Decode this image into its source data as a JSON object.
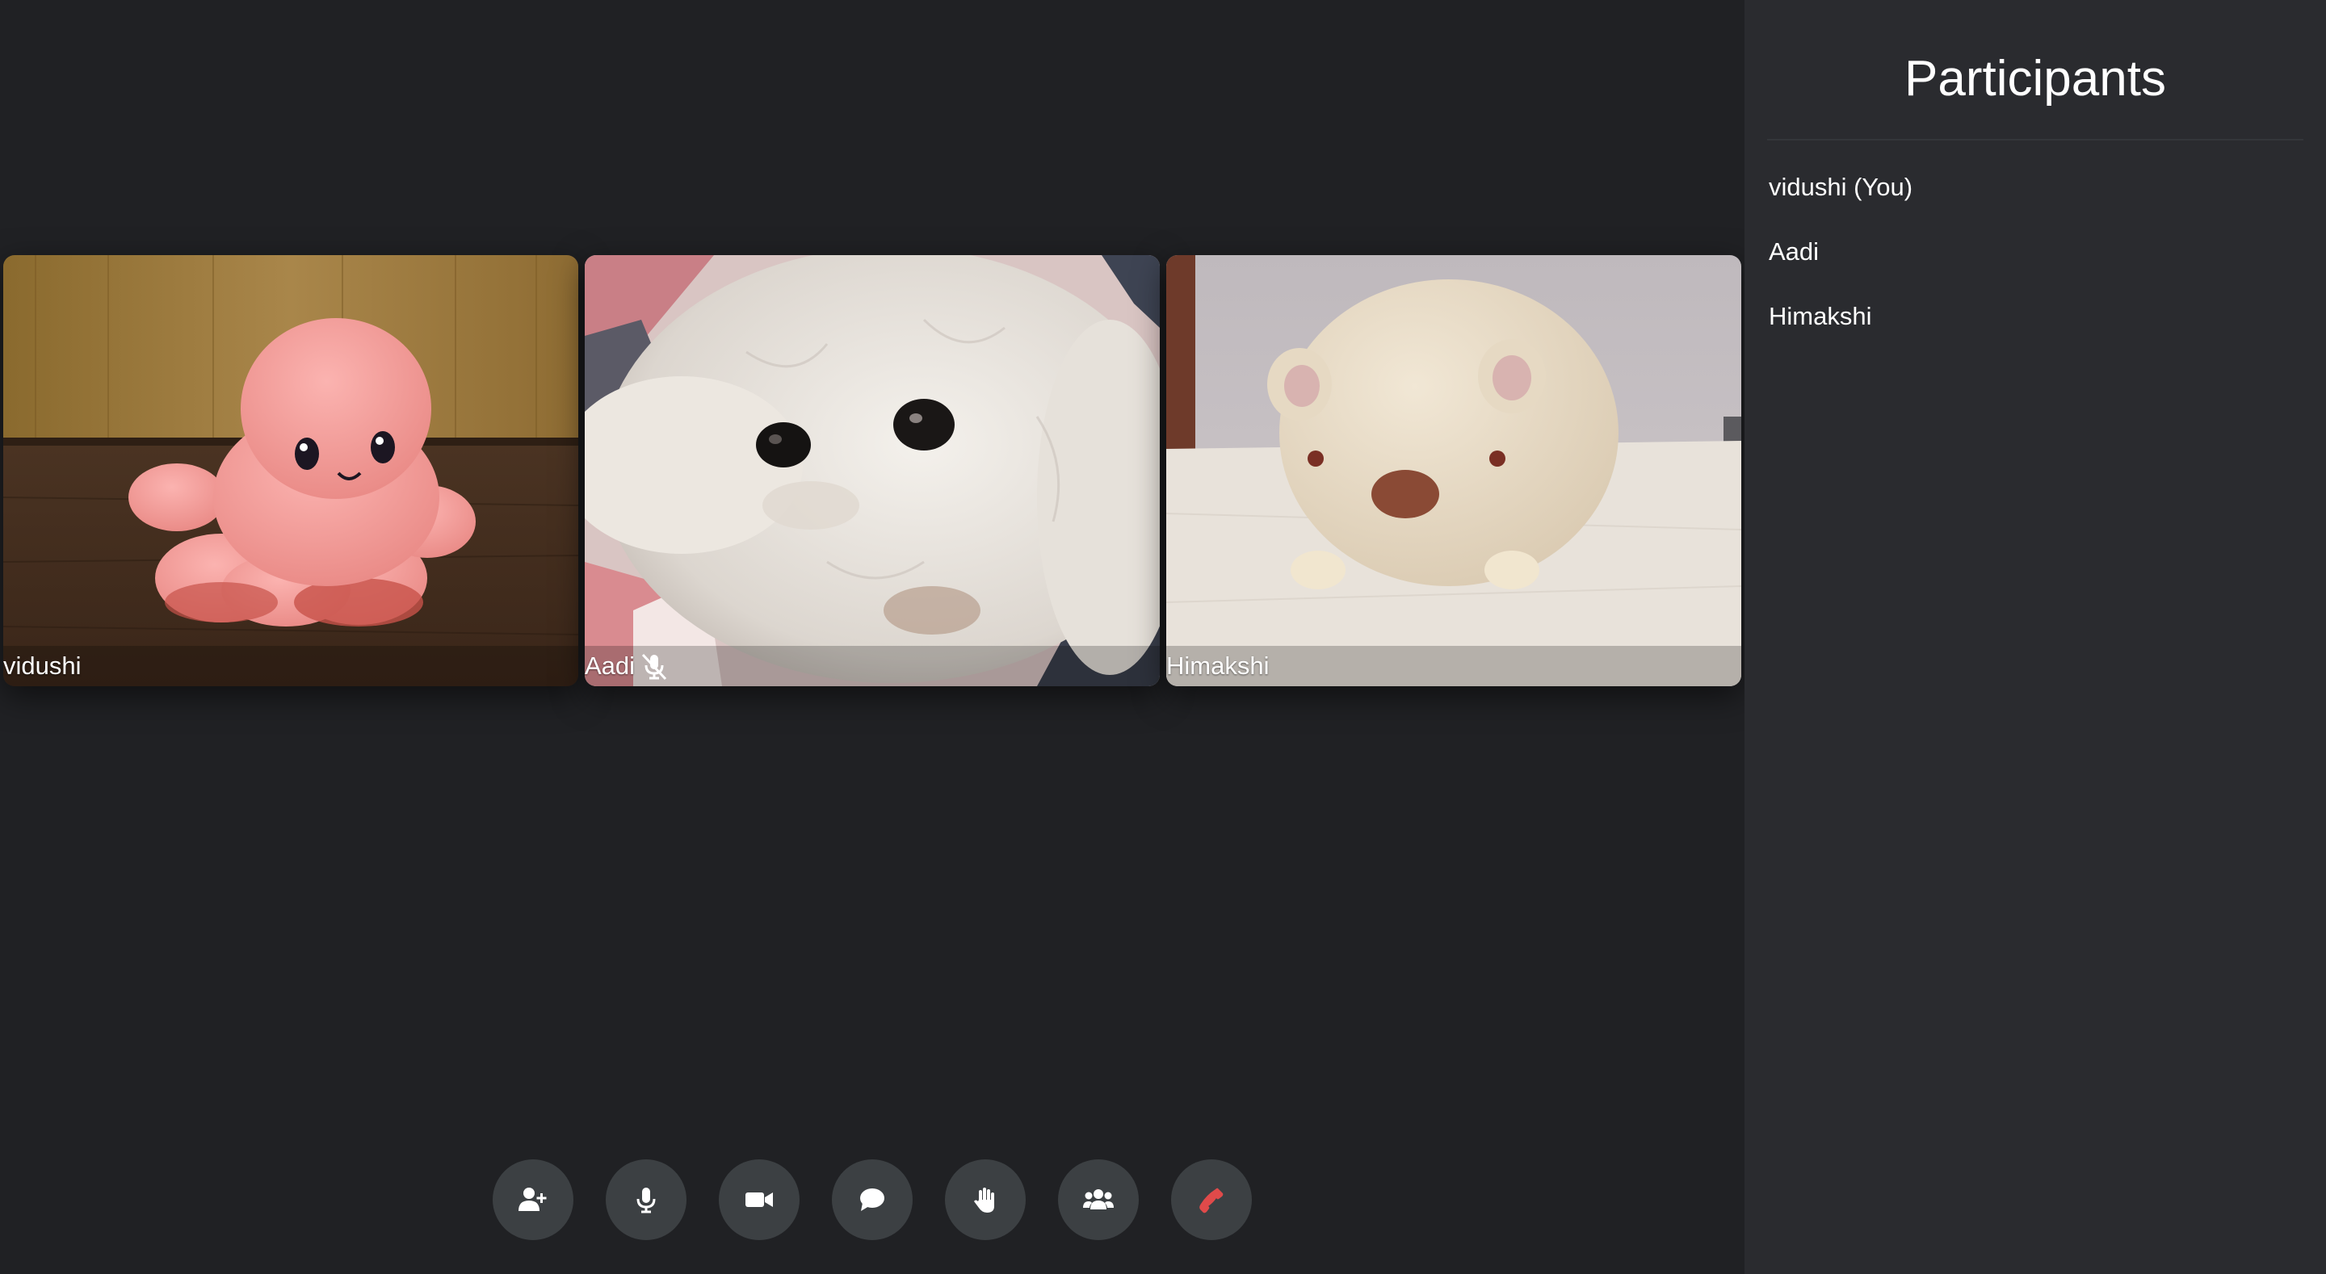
{
  "participants_panel": {
    "title": "Participants",
    "items": [
      {
        "label": "vidushi (You)"
      },
      {
        "label": "Aadi"
      },
      {
        "label": "Himakshi"
      }
    ]
  },
  "tiles": [
    {
      "name": "vidushi",
      "muted": false
    },
    {
      "name": "Aadi",
      "muted": true
    },
    {
      "name": "Himakshi",
      "muted": false
    }
  ],
  "controls": [
    {
      "icon": "add-user-icon"
    },
    {
      "icon": "microphone-icon"
    },
    {
      "icon": "video-camera-icon"
    },
    {
      "icon": "chat-bubble-icon"
    },
    {
      "icon": "raise-hand-icon"
    },
    {
      "icon": "participants-icon"
    },
    {
      "icon": "end-call-icon"
    }
  ],
  "colors": {
    "background": "#202124",
    "panel": "#2a2b2f",
    "control_button": "#3c4043",
    "end_call": "#e04a4a"
  }
}
